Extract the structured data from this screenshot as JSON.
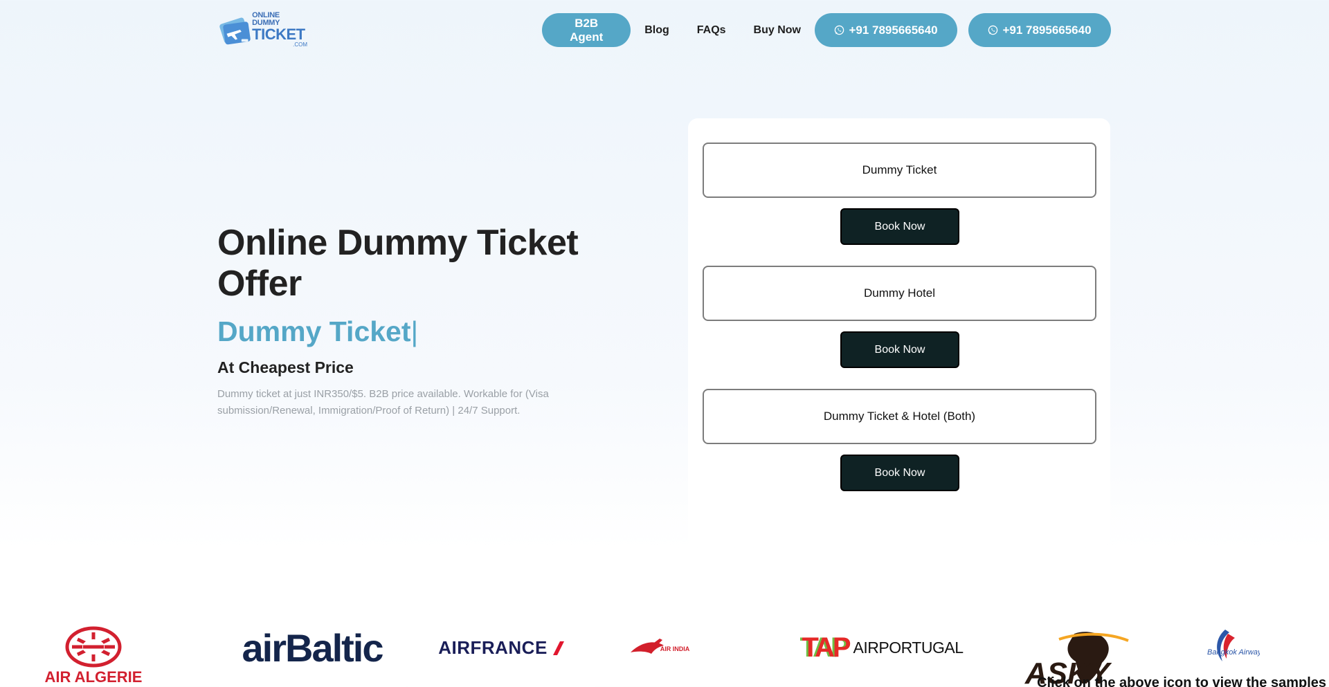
{
  "header": {
    "logo": {
      "line1": "ONLINE DUMMY",
      "line2": "TICKET",
      "line3": ".COM"
    },
    "nav": {
      "b2b_label": "B2B Agent",
      "blog_label": "Blog",
      "faqs_label": "FAQs",
      "buy_label": "Buy Now",
      "phone1": "+91 7895665640",
      "phone2": "+91 7895665640"
    }
  },
  "hero": {
    "title": "Online Dummy Ticket Offer",
    "typed_text": "Dummy Ticket",
    "cursor": "|",
    "subtitle": "At Cheapest Price",
    "description": "Dummy ticket at just INR350/$5. B2B price available. Workable for (Visa submission/Renewal, Immigration/Proof of Return) | 24/7 Support."
  },
  "booking": {
    "options": [
      {
        "label": "Dummy Ticket",
        "button": "Book Now"
      },
      {
        "label": "Dummy Hotel",
        "button": "Book Now"
      },
      {
        "label": "Dummy Ticket & Hotel (Both)",
        "button": "Book Now"
      }
    ]
  },
  "airlines": {
    "air_algerie": "AIR ALGERIE",
    "airbaltic": "airBaltic",
    "airfrance": "AIRFRANCE",
    "airindia": "AIR INDIA",
    "tap_mark": "TAP",
    "tap_text": "AIRPORTUGAL",
    "asky": "ASKY",
    "bangkok": "Bangkok Airways"
  },
  "footer_note": "Click on the above icon to view the samples"
}
